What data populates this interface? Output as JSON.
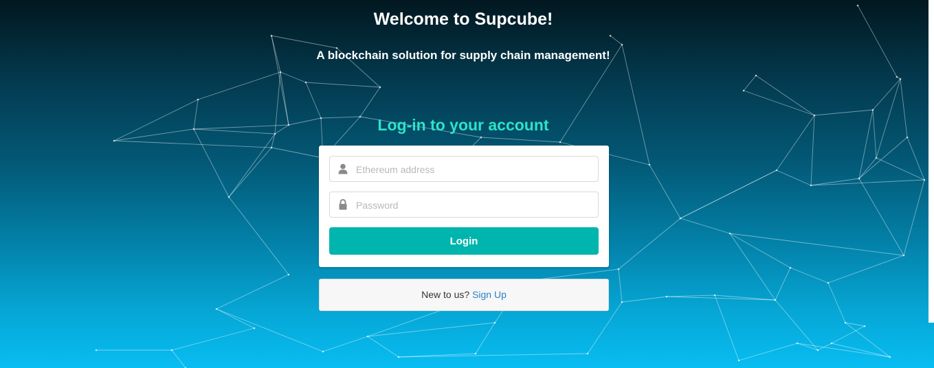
{
  "hero": {
    "title": "Welcome to Supcube!",
    "subtitle": "A blockchain solution for supply chain management!"
  },
  "login": {
    "heading": "Log-in to your account",
    "ethereum_placeholder": "Ethereum address",
    "password_placeholder": "Password",
    "button_label": "Login",
    "user_icon": "user-icon",
    "lock_icon": "lock-icon"
  },
  "signup": {
    "prompt": "New to us?",
    "link_label": "Sign Up"
  },
  "colors": {
    "accent": "#00b5ad",
    "heading": "#2de3c8",
    "link": "#2a7fc4",
    "gradient_top": "#02171f",
    "gradient_bottom": "#08bdf2"
  }
}
